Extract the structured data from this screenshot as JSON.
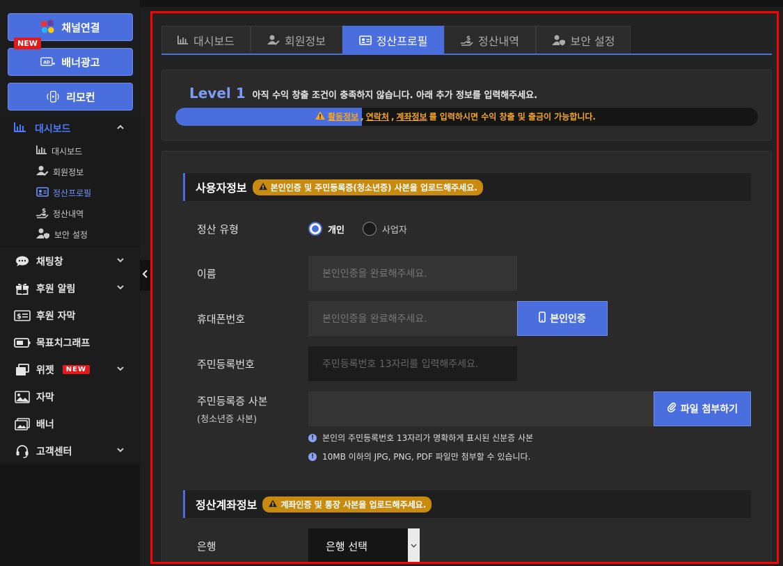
{
  "sidebar": {
    "top_buttons": {
      "channel_connect": "채널연결",
      "banner_ads": "배너광고",
      "banner_new_badge": "NEW",
      "remote": "리모컨"
    },
    "dashboard_group": {
      "label": "대시보드",
      "items": [
        {
          "label": "대시보드",
          "icon": "bar-chart-icon"
        },
        {
          "label": "회원정보",
          "icon": "user-edit-icon"
        },
        {
          "label": "정산프로필",
          "icon": "id-card-icon",
          "active": true
        },
        {
          "label": "정산내역",
          "icon": "money-hand-icon"
        },
        {
          "label": "보안 설정",
          "icon": "user-shield-icon"
        }
      ]
    },
    "nav_items": [
      {
        "label": "채팅창",
        "icon": "chat-bubble-icon",
        "has_chevron": true
      },
      {
        "label": "후원 알림",
        "icon": "gift-icon",
        "has_chevron": true
      },
      {
        "label": "후원 자막",
        "icon": "ticket-icon",
        "has_chevron": false
      },
      {
        "label": "목표치그래프",
        "icon": "battery-icon",
        "has_chevron": false
      },
      {
        "label": "위젯",
        "icon": "windows-icon",
        "has_chevron": true,
        "badge": "NEW"
      },
      {
        "label": "자막",
        "icon": "image-text-icon",
        "has_chevron": false
      },
      {
        "label": "배너",
        "icon": "picture-icon",
        "has_chevron": false
      },
      {
        "label": "고객센터",
        "icon": "headset-icon",
        "has_chevron": true
      }
    ]
  },
  "tabs": [
    {
      "label": "대시보드",
      "icon": "bar-chart-icon"
    },
    {
      "label": "회원정보",
      "icon": "user-edit-icon"
    },
    {
      "label": "정산프로필",
      "icon": "id-card-icon",
      "active": true
    },
    {
      "label": "정산내역",
      "icon": "money-hand-icon"
    },
    {
      "label": "보안 설정",
      "icon": "user-shield-icon"
    }
  ],
  "level": {
    "title": "Level 1",
    "message": "아직 수익 창출 조건이 충족하지 않습니다. 아래 추가 정보를 입력해주세요.",
    "progress_fraction": 0.32,
    "progress_parts": {
      "activity": "활동정보",
      "sep1": ",",
      "contact": "연락처",
      "sep2": ",",
      "account": "계좌정보",
      "suffix": "를 입력하시면 수익 창출 및 출금이 가능합니다."
    }
  },
  "user_section": {
    "title": "사용자정보",
    "warning": "본인인증 및 주민등록증(청소년증) 사본을 업로드해주세요.",
    "settlement_type_label": "정산 유형",
    "type_options": [
      {
        "label": "개인",
        "selected": true
      },
      {
        "label": "사업자",
        "selected": false
      }
    ],
    "name_label": "이름",
    "name_placeholder": "본인인증을 완료해주세요.",
    "phone_label": "휴대폰번호",
    "phone_placeholder": "본인인증을 완료해주세요.",
    "verify_button": "본인인증",
    "rrn_label": "주민등록번호",
    "rrn_placeholder": "주민등록번호 13자리를 입력해주세요.",
    "copy_label_line1": "주민등록증 사본",
    "copy_label_line2": "(청소년증 사본)",
    "attach_button": "파일 첨부하기",
    "notes": [
      "본인의 주민등록번호 13자리가 명확하게 표시된 신분증 사본",
      "10MB 이하의 JPG, PNG, PDF 파일만 첨부할 수 있습니다."
    ]
  },
  "account_section": {
    "title": "정산계좌정보",
    "warning": "계좌인증 및 통장 사본을 업로드해주세요.",
    "bank_label": "은행",
    "bank_select": "은행 선택"
  },
  "colors": {
    "accent": "#4a6ede",
    "warning": "#c98a10",
    "highlight_border": "#ff0000"
  }
}
